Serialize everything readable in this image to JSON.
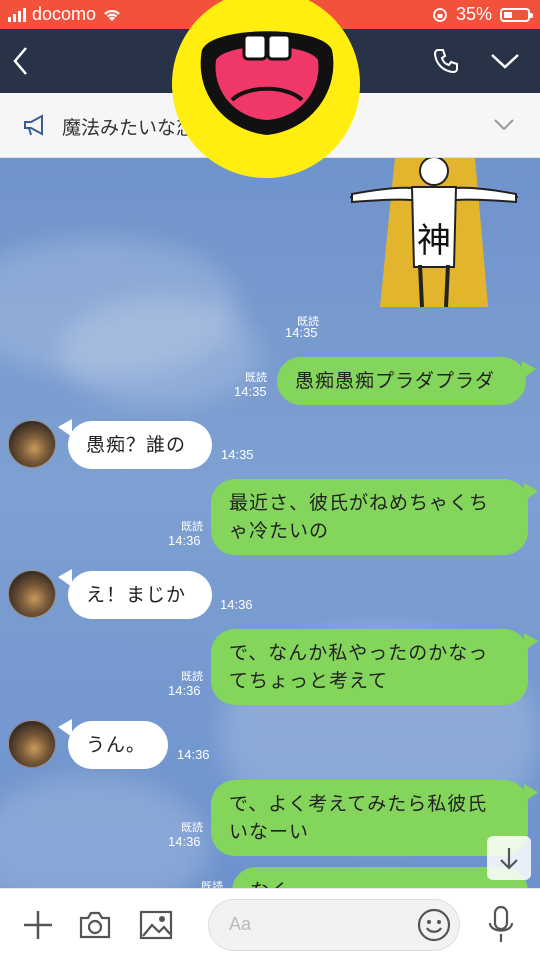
{
  "status": {
    "carrier": "docomo",
    "battery": "35%"
  },
  "announcement": {
    "text": "魔法みたいな恋"
  },
  "input": {
    "placeholder": "Aa"
  },
  "sticker_text": "神",
  "messages": [
    {
      "side": "right",
      "type": "sticker",
      "read": "既読",
      "time": "14:35"
    },
    {
      "side": "right",
      "text": "愚痴愚痴プラダプラダ",
      "read": "既読",
      "time": "14:35"
    },
    {
      "side": "left",
      "text": "愚痴？誰の",
      "time": "14:35"
    },
    {
      "side": "right",
      "text": "最近さ、彼氏がねめちゃくちゃ冷たいの",
      "line1": "最近さ、彼氏がねめちゃくち",
      "line2": "ゃ冷たいの",
      "read": "既読",
      "time": "14:36"
    },
    {
      "side": "left",
      "text": "え！まじか",
      "time": "14:36"
    },
    {
      "side": "right",
      "text": "で、なんか私やったのかなってちょっと考えて",
      "line1": "で、なんか私やったのかなっ",
      "line2": "てちょっと考えて",
      "read": "既読",
      "time": "14:36"
    },
    {
      "side": "left",
      "text": "うん。",
      "time": "14:36"
    },
    {
      "side": "right",
      "text": "で、よく考えてみたら私彼氏いなーい",
      "line1": "で、よく考えてみたら私彼氏",
      "line2": "いなーい",
      "read": "既読",
      "time": "14:36"
    },
    {
      "side": "right",
      "text": "なく",
      "read": "既読"
    }
  ]
}
